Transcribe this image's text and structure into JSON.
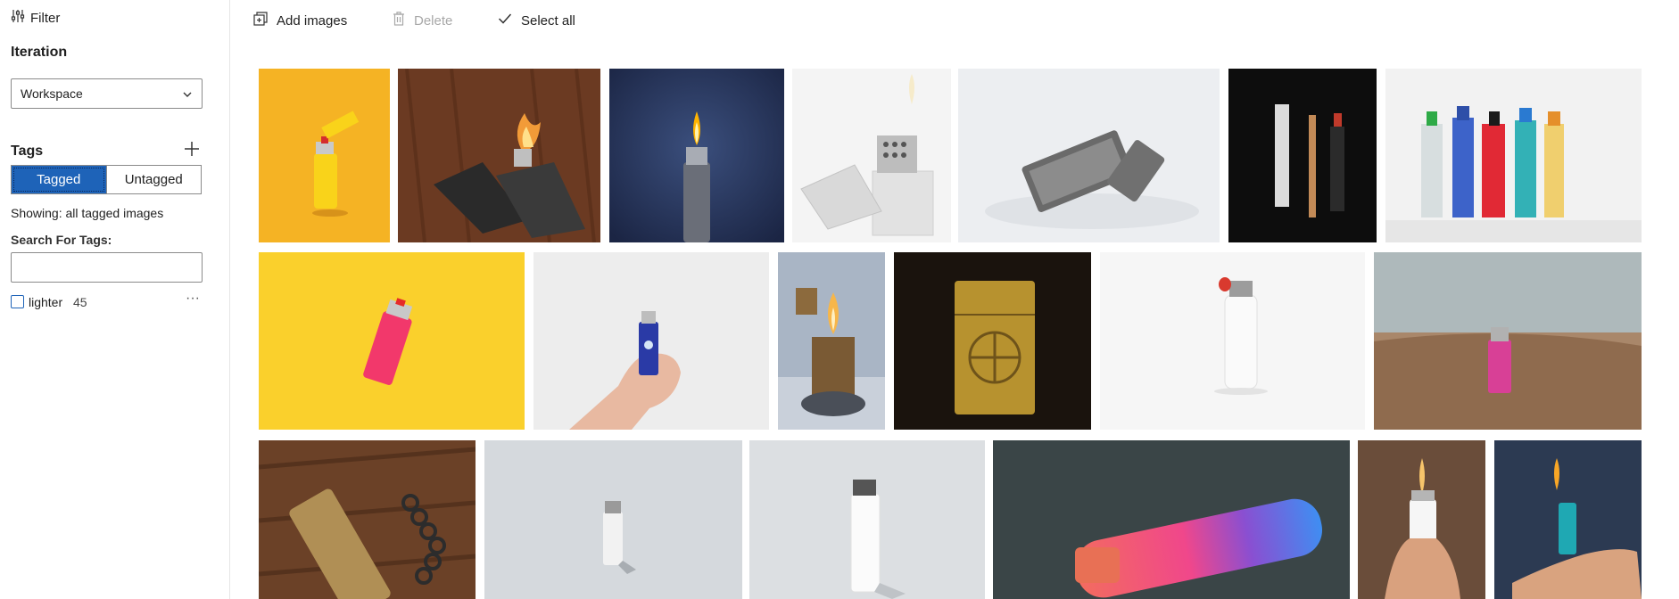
{
  "sidebar": {
    "filter_label": "Filter",
    "iteration_title": "Iteration",
    "iteration_select": "Workspace",
    "tags_title": "Tags",
    "segment": {
      "tagged": "Tagged",
      "untagged": "Untagged",
      "active": "tagged"
    },
    "showing_text": "Showing: all tagged images",
    "search_label": "Search For Tags:",
    "search_value": "",
    "tags": [
      {
        "name": "lighter",
        "count": "45",
        "checked": false
      }
    ]
  },
  "toolbar": {
    "add_label": "Add images",
    "delete_label": "Delete",
    "select_all_label": "Select all"
  },
  "gallery": {
    "images": [
      {
        "name": "image-yellow-bic-lighter",
        "subject": "yellow disposable lighter on orange background"
      },
      {
        "name": "image-zippo-on-wood",
        "subject": "open zippo lighter with flame on wooden table"
      },
      {
        "name": "image-lighter-flame-blue",
        "subject": "lighter with flame on dark blue background"
      },
      {
        "name": "image-silver-zippo-white",
        "subject": "silver zippo lighter open on white"
      },
      {
        "name": "image-engraved-zippo",
        "subject": "engraved silver zippo lying on white"
      },
      {
        "name": "image-three-items-black",
        "subject": "crystal, joint and lighter on black"
      },
      {
        "name": "image-colorful-lighters-row",
        "subject": "row of colorful disposable lighters"
      },
      {
        "name": "image-pink-lighter-yellow",
        "subject": "pink lighter on yellow background"
      },
      {
        "name": "image-hand-holding-lighter",
        "subject": "hand holding a blue lighter"
      },
      {
        "name": "image-vintage-brass-lighter",
        "subject": "vintage brass lighter with flame"
      },
      {
        "name": "image-gold-ornate-zippo",
        "subject": "gold ornate zippo on dark background"
      },
      {
        "name": "image-white-lighter",
        "subject": "white lighter on white"
      },
      {
        "name": "image-pink-lighter-sand",
        "subject": "pink lighter in beach sand"
      },
      {
        "name": "image-brass-lighter-chain",
        "subject": "brass lighter with chain on wood"
      },
      {
        "name": "image-small-white-lighter",
        "subject": "small white lighter on grey"
      },
      {
        "name": "image-tall-white-lighter",
        "subject": "tall white lighter on grey"
      },
      {
        "name": "image-gradient-lighter",
        "subject": "gradient colored lighter on dark fabric"
      },
      {
        "name": "image-hand-white-lighter",
        "subject": "hand holding white lighter with flame"
      },
      {
        "name": "image-palm-lighter-flame",
        "subject": "palm holding lighter with flame"
      }
    ]
  }
}
